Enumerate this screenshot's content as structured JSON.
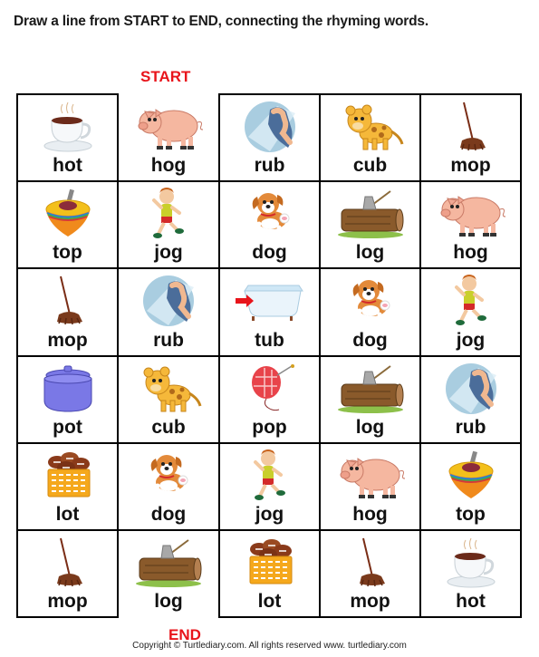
{
  "instructions": "Draw a line from START to END, connecting the rhyming words.",
  "start_label": "START",
  "end_label": "END",
  "copyright": "Copyright © Turtlediary.com. All rights reserved   www. turtlediary.com",
  "colors": {
    "label_red": "#e8141b",
    "grid_line": "#000000"
  },
  "grid": {
    "rows": 6,
    "cols": 5,
    "start_cell": {
      "row": 1,
      "col": 2
    },
    "end_cell": {
      "row": 6,
      "col": 2
    },
    "cells": [
      [
        {
          "word": "hot",
          "icon": "teacup-icon"
        },
        {
          "word": "hog",
          "icon": "pig-icon"
        },
        {
          "word": "rub",
          "icon": "hand-rub-icon"
        },
        {
          "word": "cub",
          "icon": "cub-icon"
        },
        {
          "word": "mop",
          "icon": "mop-icon"
        }
      ],
      [
        {
          "word": "top",
          "icon": "spinning-top-icon"
        },
        {
          "word": "jog",
          "icon": "jogging-boy-icon"
        },
        {
          "word": "dog",
          "icon": "dog-icon"
        },
        {
          "word": "log",
          "icon": "log-icon"
        },
        {
          "word": "hog",
          "icon": "pig-icon"
        }
      ],
      [
        {
          "word": "mop",
          "icon": "mop-icon"
        },
        {
          "word": "rub",
          "icon": "hand-rub-icon"
        },
        {
          "word": "tub",
          "icon": "bathtub-icon"
        },
        {
          "word": "dog",
          "icon": "dog-icon"
        },
        {
          "word": "jog",
          "icon": "jogging-boy-icon"
        }
      ],
      [
        {
          "word": "pot",
          "icon": "pot-icon"
        },
        {
          "word": "cub",
          "icon": "cub-icon"
        },
        {
          "word": "pop",
          "icon": "balloon-pop-icon"
        },
        {
          "word": "log",
          "icon": "log-icon"
        },
        {
          "word": "rub",
          "icon": "hand-rub-icon"
        }
      ],
      [
        {
          "word": "lot",
          "icon": "basket-of-balls-icon"
        },
        {
          "word": "dog",
          "icon": "dog-icon"
        },
        {
          "word": "jog",
          "icon": "jogging-boy-icon"
        },
        {
          "word": "hog",
          "icon": "pig-icon"
        },
        {
          "word": "top",
          "icon": "spinning-top-icon"
        }
      ],
      [
        {
          "word": "mop",
          "icon": "mop-icon"
        },
        {
          "word": "log",
          "icon": "log-icon"
        },
        {
          "word": "lot",
          "icon": "basket-of-balls-icon"
        },
        {
          "word": "mop",
          "icon": "mop-icon"
        },
        {
          "word": "hot",
          "icon": "teacup-icon"
        }
      ]
    ]
  }
}
